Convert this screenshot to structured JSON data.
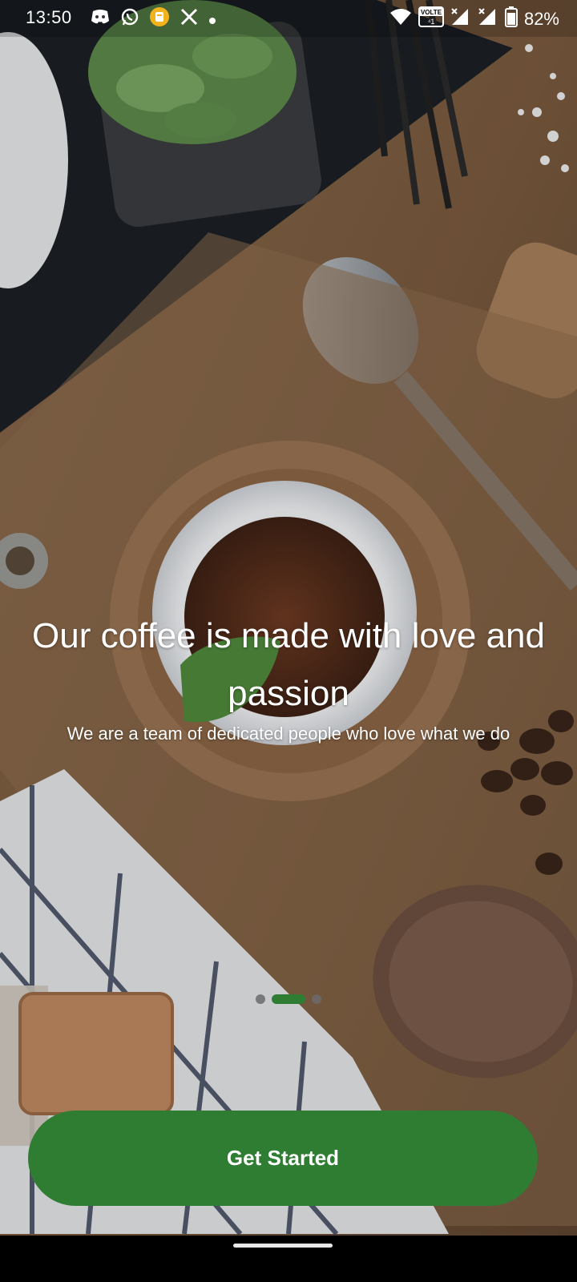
{
  "status_bar": {
    "time": "13:50",
    "battery": "82%",
    "volte": "VOLTE",
    "icons": [
      "discord-icon",
      "whatsapp-icon",
      "notification-app-icon",
      "x-icon",
      "dot-icon",
      "wifi-icon",
      "volte-icon",
      "signal-icon",
      "signal-icon",
      "battery-icon"
    ]
  },
  "onboarding": {
    "headline": "Our coffee is made with love and passion",
    "subtitle": "We are a team of dedicated people who love what we do",
    "pages_total": 3,
    "current_page": 2
  },
  "cta": {
    "label": "Get Started"
  },
  "colors": {
    "accent": "#2e7d32",
    "indicator_inactive": "#6b6b6b",
    "text": "#ffffff"
  }
}
